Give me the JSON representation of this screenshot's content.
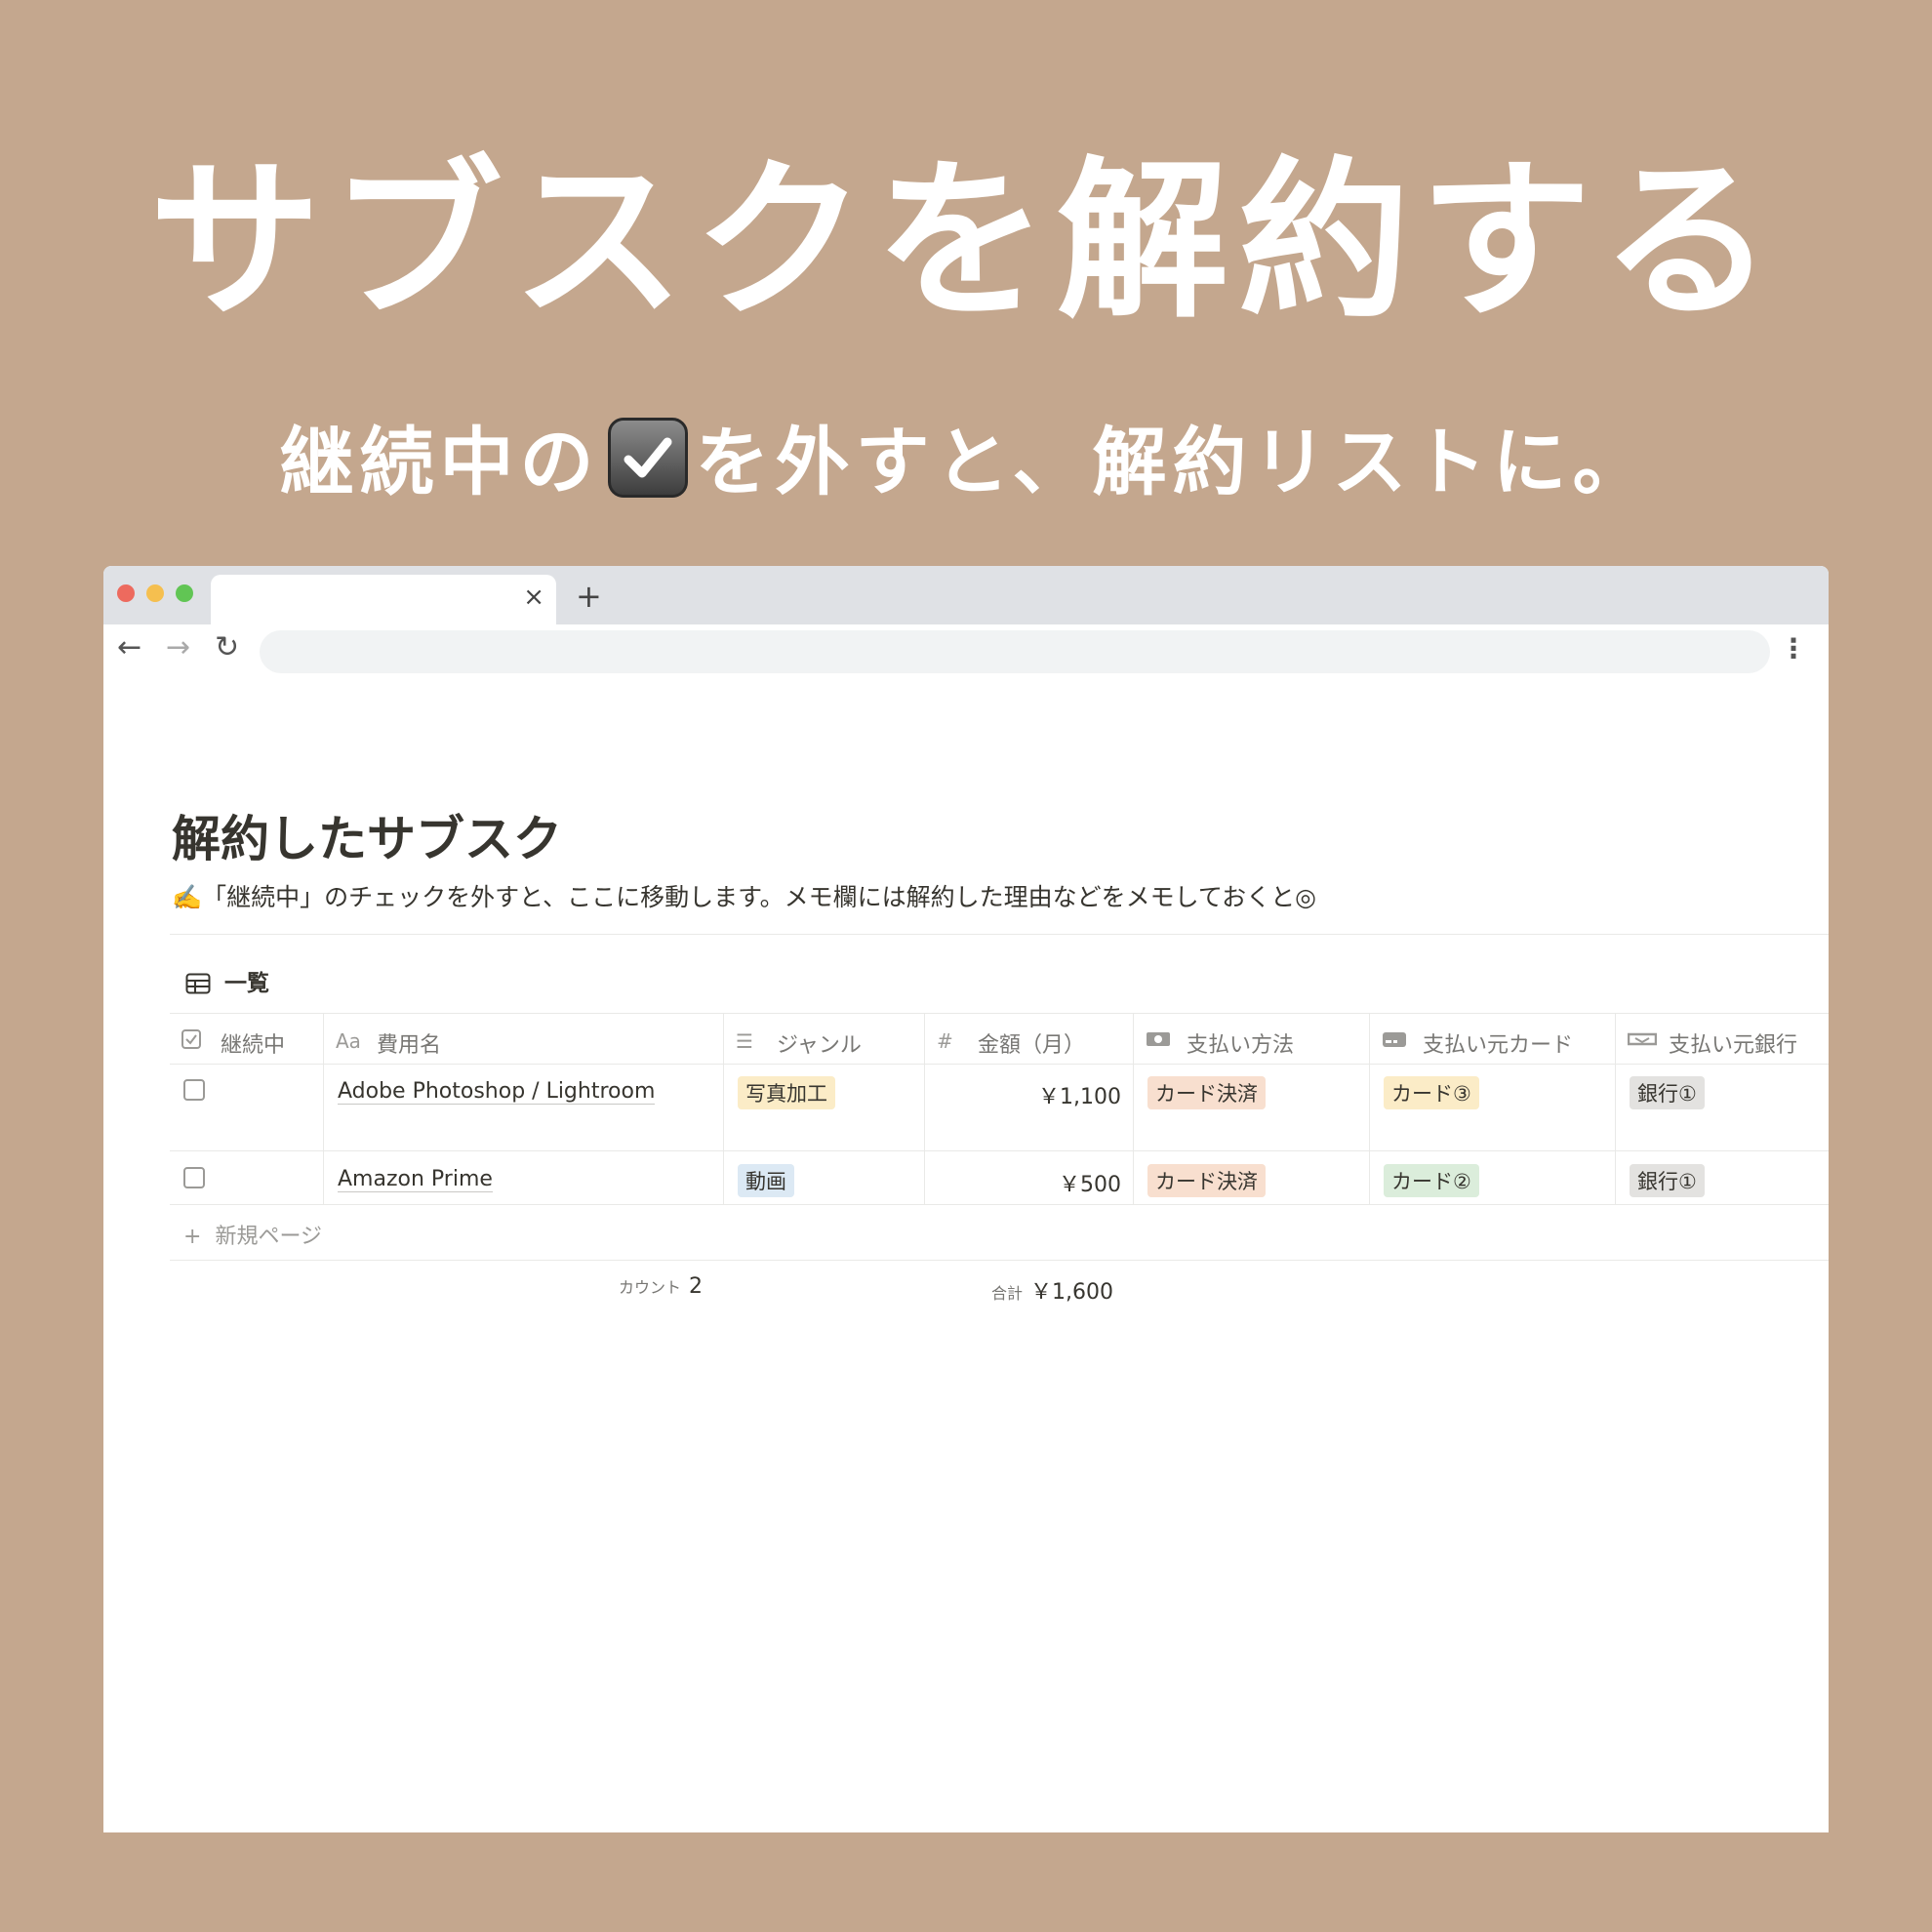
{
  "headline": "サブスクを解約する",
  "subline": {
    "before": "継続中の",
    "checkbox_icon": "ballot-box-with-check",
    "after": "を外すと、解約リストに。"
  },
  "colors": {
    "background": "#c4a78e",
    "tag_beige": "#fbecc7",
    "tag_blue": "#dce9f4",
    "tag_orange": "#f8dfcf",
    "tag_yellow": "#fbecc7",
    "tag_green": "#dbeddb",
    "tag_gray": "#e3e2e0"
  },
  "browser": {
    "tab_close": "×",
    "new_tab": "+",
    "back": "←",
    "forward": "→",
    "reload": "↻",
    "menu": "⋮"
  },
  "page": {
    "title": "解約したサブスク",
    "description": "✍️「継続中」のチェックを外すと、ここに移動します。メモ欄には解約した理由などをメモしておくと◎",
    "view_name": "一覧"
  },
  "table": {
    "headers": {
      "active": "継続中",
      "name_icon": "Aa",
      "name": "費用名",
      "genre_icon": "☰",
      "genre": "ジャンル",
      "amount_icon": "#",
      "amount": "金額（月）",
      "method": "支払い方法",
      "card": "支払い元カード",
      "bank": "支払い元銀行"
    },
    "rows": [
      {
        "checked": false,
        "name": "Adobe Photoshop / Lightroom",
        "genre": "写真加工",
        "amount": "￥1,100",
        "method": "カード決済",
        "card": "カード③",
        "bank": "銀行①"
      },
      {
        "checked": false,
        "name": "Amazon Prime",
        "genre": "動画",
        "amount": "￥500",
        "method": "カード決済",
        "card": "カード②",
        "bank": "銀行①"
      }
    ],
    "new_page_plus": "+",
    "new_page": "新規ページ",
    "footer": {
      "count_label": "カウント",
      "count_value": "2",
      "sum_label": "合計",
      "sum_value": "￥1,600"
    }
  }
}
